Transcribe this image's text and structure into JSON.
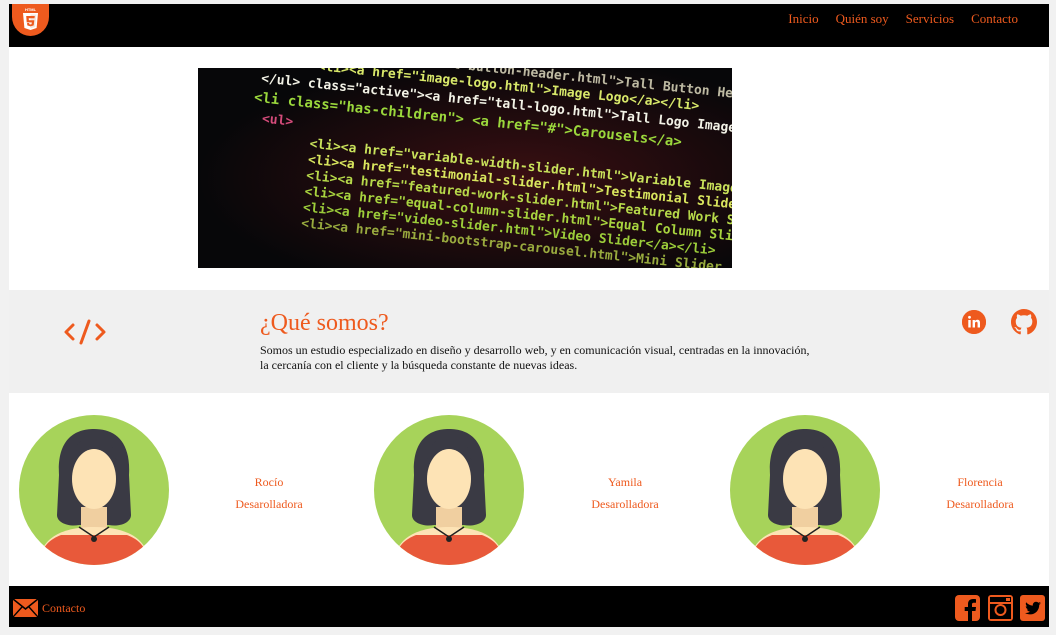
{
  "header": {
    "logo_text": "HTML",
    "nav": [
      "Inicio",
      "Quién soy",
      "Servicios",
      "Contacto"
    ]
  },
  "hero": {
    "code_lines": [
      "<a href=\"tall-button-header.html\">Tall Button Header</a>",
      "<li><a href=\"image-logo.html\">Image Logo</a></li>",
      "</ul>  class=\"active\"><a href=\"tall-logo.html\">Tall Logo Image</a>",
      "<li class=\"has-children\"> <a href=\"#\">Carousels</a>",
      "<ul>",
      "<li><a href=\"variable-width-slider.html\">Variable Image Wi",
      "<li><a href=\"testimonial-slider.html\">Testimonial Slider</a>",
      "<li><a href=\"featured-work-slider.html\">Featured Work Sli",
      "<li><a href=\"equal-column-slider.html\">Equal Column Slid",
      "<li><a href=\"video-slider.html\">Video Slider</a></li>",
      "<li><a href=\"mini-bootstrap-carousel.html\">Mini Slider"
    ]
  },
  "about": {
    "icon": "code-icon",
    "title": "¿Qué somos?",
    "description": "Somos un estudio especializado en diseño y desarrollo web, y en comunicación visual, centradas en la innovación, la cercanía con el cliente y la búsqueda constante de nuevas ideas.",
    "social": [
      "linkedin-icon",
      "github-icon"
    ]
  },
  "team": [
    {
      "name": "Rocío",
      "role": "Desarolladora"
    },
    {
      "name": "Yamila",
      "role": "Desarolladora"
    },
    {
      "name": "Florencia",
      "role": "Desarolladora"
    }
  ],
  "footer": {
    "contact_label": "Contacto",
    "social": [
      "facebook-icon",
      "instagram-icon",
      "twitter-icon"
    ]
  },
  "colors": {
    "accent": "#ee5a1e",
    "dark": "#000000",
    "band": "#f0f0f0",
    "avatar_bg": "#a7d35a"
  }
}
